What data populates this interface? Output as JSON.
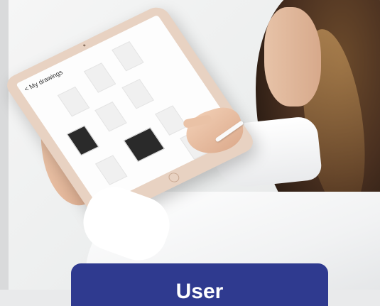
{
  "scene": {
    "device_screen_title": "< My drawings"
  },
  "banner": {
    "label": "User",
    "color": "#2f3a8f"
  }
}
